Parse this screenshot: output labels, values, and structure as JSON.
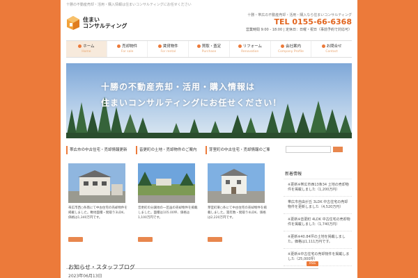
{
  "header": {
    "tagline": "十勝の不動産売却・活用・購入情報は住まいコンサルティングにお任せください",
    "logo_text": [
      "住まい",
      "コンサルティング"
    ],
    "description": "十勝・帯広の不動産売却・活用・購入なら住まいコンサルティング",
    "tel": "TEL 0155-66-6368",
    "hours": "営業時間 9:00 - 18:00 | 定休日：日曜・祝日（事前予約で対応可）"
  },
  "nav": [
    {
      "label": "ホーム",
      "sub": "Home",
      "active": true
    },
    {
      "label": "売却物件",
      "sub": "For sale"
    },
    {
      "label": "賃貸物件",
      "sub": "For rental"
    },
    {
      "label": "買取・査定",
      "sub": "Purchase"
    },
    {
      "label": "リフォーム",
      "sub": "Renovation"
    },
    {
      "label": "会社案内",
      "sub": "Company Profile"
    },
    {
      "label": "お問合せ",
      "sub": "Contact"
    }
  ],
  "hero": {
    "line1": "十勝の不動産売却・活用・購入情報は",
    "line2": "住まいコンサルティングにお任せください！"
  },
  "cards": [
    {
      "title": "帯広市の中古住宅・売却情報更新",
      "text": "帯広市西○条南にて中古住宅の売却物件を掲載しました。敷地面積・間取り3LDK、価格は1,340万円です。"
    },
    {
      "title": "音更町の土地・売却物件のご案内",
      "text": "音更町の分譲地の一区画の売却物件を掲載しました。面積は105.00坪、価格は1,100万円です。"
    },
    {
      "title": "芽室町の中古住宅・売却情報のご案内",
      "text": "芽室町東○条にて中古住宅の売却物件を掲載しました。築年数・間取り4LDK、価格は2,220万円です。"
    }
  ],
  "sidebar": {
    "search_placeholder": "",
    "heading": "新着情報",
    "items": [
      "※更新※帯広市西13条34 土地の売却物件を掲載しました（1,200万円）",
      "帯広市自由が丘 3LDK 中古住宅の売却物件を更新しました（4,520万円）",
      "※更新※音更町 4LDK 中古住宅の売却物件を掲載しました（1,740万円）",
      "※更新※40.84坪の土地を掲載しました。価格は1,111万円です。",
      "※更新※中古住宅の売却物件を掲載しました（25,000坪）"
    ]
  },
  "news": {
    "title": "お知らせ・スタッフブログ",
    "rss": "RSS",
    "date": "2023年06月13日"
  },
  "colors": {
    "accent": "#ec7a3a",
    "tel": "#e2651f",
    "button": "#e8874e"
  }
}
